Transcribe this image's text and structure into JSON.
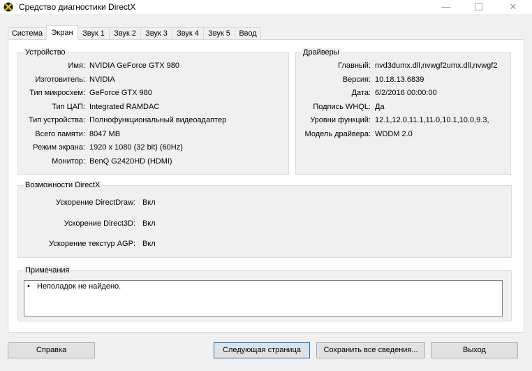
{
  "window": {
    "title": "Средство диагностики DirectX"
  },
  "tabs": [
    "Система",
    "Экран",
    "Звук 1",
    "Звук 2",
    "Звук 3",
    "Звук 4",
    "Звук 5",
    "Ввод"
  ],
  "device": {
    "title": "Устройство",
    "rows": [
      {
        "label": "Имя:",
        "value": "NVIDIA GeForce GTX 980"
      },
      {
        "label": "Изготовитель:",
        "value": "NVIDIA"
      },
      {
        "label": "Тип микросхем:",
        "value": "GeForce GTX 980"
      },
      {
        "label": "Тип ЦАП:",
        "value": "Integrated RAMDAC"
      },
      {
        "label": "Тип устройства:",
        "value": "Полнофункциональный видеоадаптер"
      },
      {
        "label": "Всего памяти:",
        "value": "8047 MB"
      },
      {
        "label": "Режим экрана:",
        "value": "1920 x 1080 (32 bit) (60Hz)"
      },
      {
        "label": "Монитор:",
        "value": "BenQ G2420HD (HDMI)"
      }
    ]
  },
  "drivers": {
    "title": "Драйверы",
    "rows": [
      {
        "label": "Главный:",
        "value": "nvd3dumx.dll,nvwgf2umx.dll,nvwgf2"
      },
      {
        "label": "Версия:",
        "value": "10.18.13.6839"
      },
      {
        "label": "Дата:",
        "value": "6/2/2016 00:00:00"
      },
      {
        "label": "Подпись WHQL:",
        "value": "Да"
      },
      {
        "label": "Уровни функций:",
        "value": "12.1,12.0,11.1,11.0,10.1,10.0,9.3,"
      },
      {
        "label": "Модель драйвера:",
        "value": "WDDM 2.0"
      }
    ]
  },
  "directx": {
    "title": "Возможности DirectX",
    "rows": [
      {
        "label": "Ускорение DirectDraw:",
        "value": "Вкл"
      },
      {
        "label": "Ускорение Direct3D:",
        "value": "Вкл"
      },
      {
        "label": "Ускорение текстур AGP:",
        "value": "Вкл"
      }
    ]
  },
  "notes": {
    "title": "Примечания",
    "bullet": "•",
    "text": "Неполадок не найдено."
  },
  "buttons": {
    "help": "Справка",
    "next": "Следующая страница",
    "save": "Сохранить все сведения...",
    "exit": "Выход"
  },
  "colors": {
    "accent": "#0078d7"
  }
}
